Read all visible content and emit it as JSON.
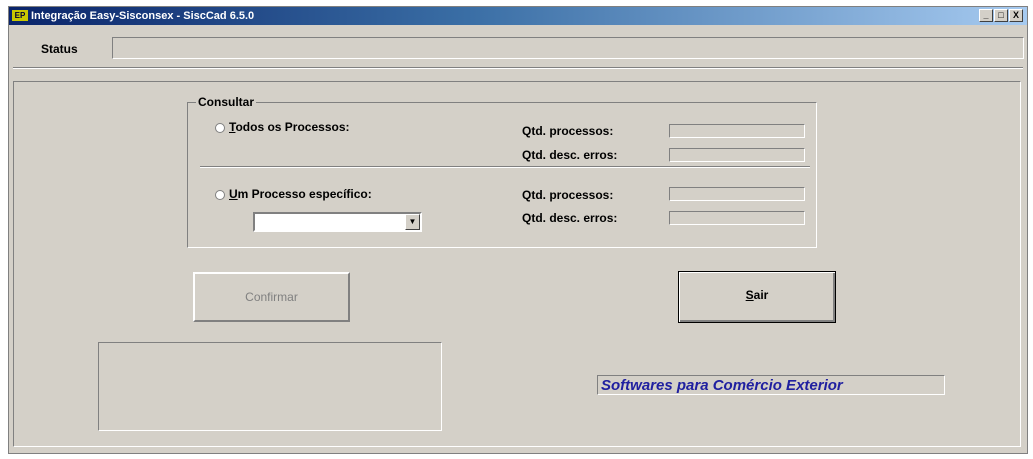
{
  "window": {
    "title": "Integração Easy-Sisconsex - SiscCad 6.5.0",
    "app_icon": "app-icon",
    "minimize_glyph": "_",
    "maximize_glyph": "□",
    "close_glyph": "X"
  },
  "status": {
    "label": "Status",
    "value": ""
  },
  "consultar": {
    "title": "Consultar",
    "all": {
      "label_accel": "T",
      "label_rest": "odos os Processos:",
      "qtd_processos_label": "Qtd. processos:",
      "qtd_processos_value": "",
      "qtd_erros_label": "Qtd. desc. erros:",
      "qtd_erros_value": ""
    },
    "one": {
      "label_accel": "U",
      "label_rest": "m Processo específico:",
      "combo_value": "",
      "combo_glyph": "▼",
      "qtd_processos_label": "Qtd. processos:",
      "qtd_processos_value": "",
      "qtd_erros_label": "Qtd. desc. erros:",
      "qtd_erros_value": ""
    }
  },
  "buttons": {
    "confirm": "Confirmar",
    "sair_accel": "S",
    "sair_rest": "air"
  },
  "tagline": "Softwares para Comércio Exterior",
  "colors": {
    "tagline": "#2020a0",
    "face": "#d4d0c8"
  }
}
